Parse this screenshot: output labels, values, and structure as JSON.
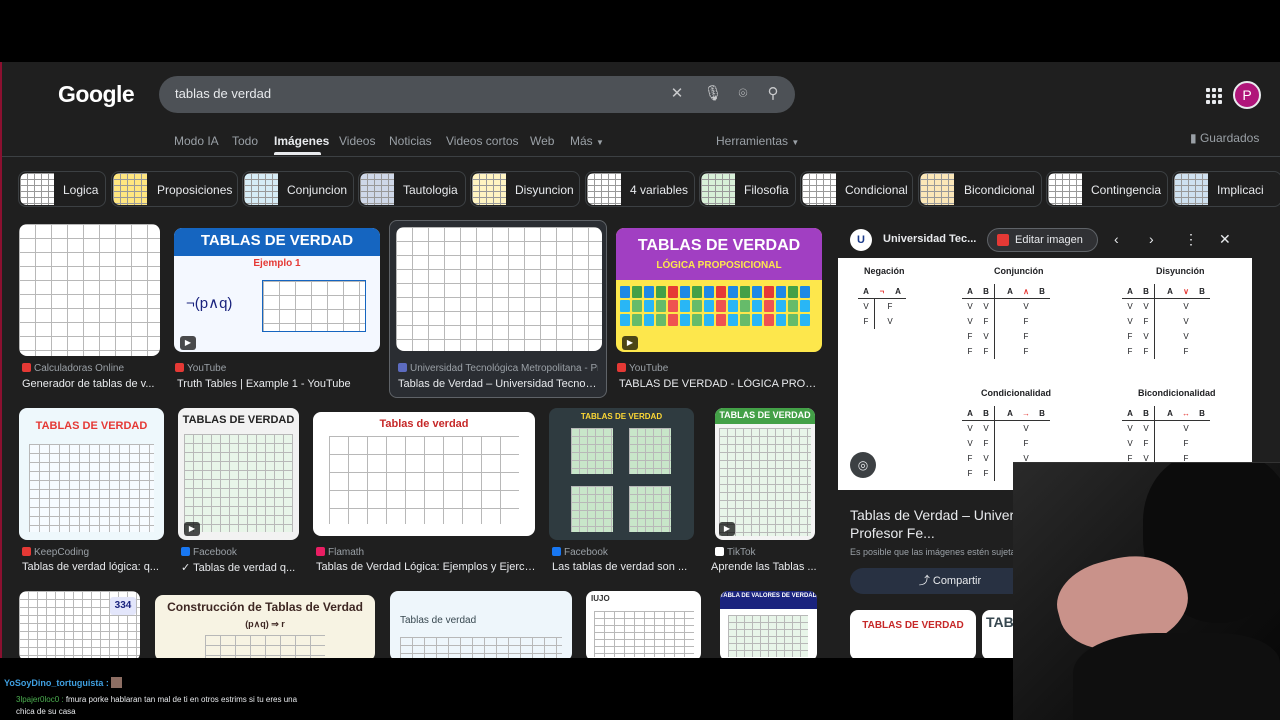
{
  "search": {
    "query": "tablas de verdad",
    "logo": "Google",
    "avatar_letter": "P"
  },
  "tabs": [
    {
      "label": "Modo IA"
    },
    {
      "label": "Todo"
    },
    {
      "label": "Imágenes"
    },
    {
      "label": "Videos"
    },
    {
      "label": "Noticias"
    },
    {
      "label": "Videos cortos"
    },
    {
      "label": "Web"
    },
    {
      "label": "Más"
    },
    {
      "label": "Herramientas"
    }
  ],
  "guardados": "Guardados",
  "chips": [
    {
      "label": "Logica"
    },
    {
      "label": "Proposiciones"
    },
    {
      "label": "Conjuncion"
    },
    {
      "label": "Tautologia"
    },
    {
      "label": "Disyuncion"
    },
    {
      "label": "4 variables"
    },
    {
      "label": "Filosofia"
    },
    {
      "label": "Condicional"
    },
    {
      "label": "Bicondicional"
    },
    {
      "label": "Contingencia"
    },
    {
      "label": "Implicaci"
    }
  ],
  "results": [
    {
      "source": "Calculadoras Online",
      "title": "Generador de tablas de v..."
    },
    {
      "source": "YouTube",
      "title": "Truth Tables | Example 1 - YouTube",
      "img_title": "TABLAS DE VERDAD",
      "img_sub": "Ejemplo 1",
      "img_formula": "¬(p∧q)"
    },
    {
      "source": "Universidad Tecnológica Metropolitana - Pro...",
      "title": "Tablas de Verdad – Universidad Tecnoló..."
    },
    {
      "source": "YouTube",
      "title": "TABLAS DE VERDAD - LÓGICA PROP...",
      "img_title": "TABLAS DE VERDAD",
      "img_sub": "LÓGICA PROPOSICIONAL"
    },
    {
      "source": "KeepCoding",
      "title": "Tablas de verdad lógica: q...",
      "img_title": "TABLAS DE VERDAD"
    },
    {
      "source": "Facebook",
      "title": "✓ Tablas de verdad q...",
      "img_title": "TABLAS DE VERDAD"
    },
    {
      "source": "Flamath",
      "title": "Tablas de Verdad Lógica: Ejemplos y Ejerci...",
      "img_title": "Tablas de verdad"
    },
    {
      "source": "Facebook",
      "title": "Las tablas de verdad son ...",
      "img_title": "TABLAS DE VERDAD"
    },
    {
      "source": "TikTok",
      "title": "Aprende las Tablas ...",
      "img_title": "TABLAS DE VERDAD"
    },
    {
      "img_title": "334"
    },
    {
      "img_title": "Construcción de Tablas de Verdad",
      "img_formula": "(p∧q) ⇒ r"
    },
    {
      "img_title": "Tablas de verdad"
    },
    {
      "img_title": "IUJO"
    },
    {
      "img_title": "TABLA DE VALORES DE VERDAD"
    }
  ],
  "panel": {
    "site": "Universidad Tec...",
    "edit_label": "Editar imagen",
    "title": "Tablas de Verdad – Universidad Tecnológica Metropolitana – Profesor Fe...",
    "note": "Es posible que las imágenes estén sujetas...",
    "share_label": "Compartir",
    "tables": {
      "negacion": "Negación",
      "conjuncion": "Conjunción",
      "disyuncion": "Disyunción",
      "condicionalidad": "Condicionalidad",
      "bicondicionalidad": "Bicondicionalidad"
    },
    "related": [
      {
        "title": "TABLAS DE VERDAD"
      },
      {
        "title": "TABL"
      }
    ]
  },
  "chat": {
    "user1": "YoSoyDino_tortuguista :",
    "user2": "3lpajer0loc0 :",
    "msg2": "fmura porke hablaran tan mal de ti en otros estrims si tu eres una chica de su casa"
  },
  "colors": {
    "page_bg": "#1f1f1f",
    "accent": "#b0157a",
    "link_blue": "#8ab4f8"
  }
}
